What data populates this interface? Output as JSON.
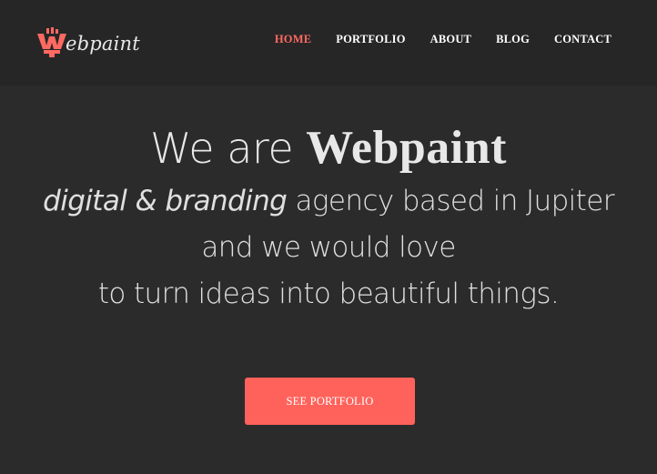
{
  "brand": {
    "logo_text": "ebpaint",
    "logo_icon": "paintbrush-w-icon",
    "accent_color": "#ff6961"
  },
  "nav": {
    "items": [
      {
        "label": "HOME",
        "active": true
      },
      {
        "label": "PORTFOLIO",
        "active": false
      },
      {
        "label": "ABOUT",
        "active": false
      },
      {
        "label": "BLOG",
        "active": false
      },
      {
        "label": "CONTACT",
        "active": false
      }
    ]
  },
  "hero": {
    "headline_prefix": "We are ",
    "headline_brand": "Webpaint",
    "line1_italic": "digital & branding",
    "line1_rest": " agency based in Jupiter",
    "line2": "and we would love",
    "line3": "to turn ideas into beautiful things."
  },
  "cta": {
    "label": "SEE PORTFOLIO",
    "color": "#ff625b"
  }
}
